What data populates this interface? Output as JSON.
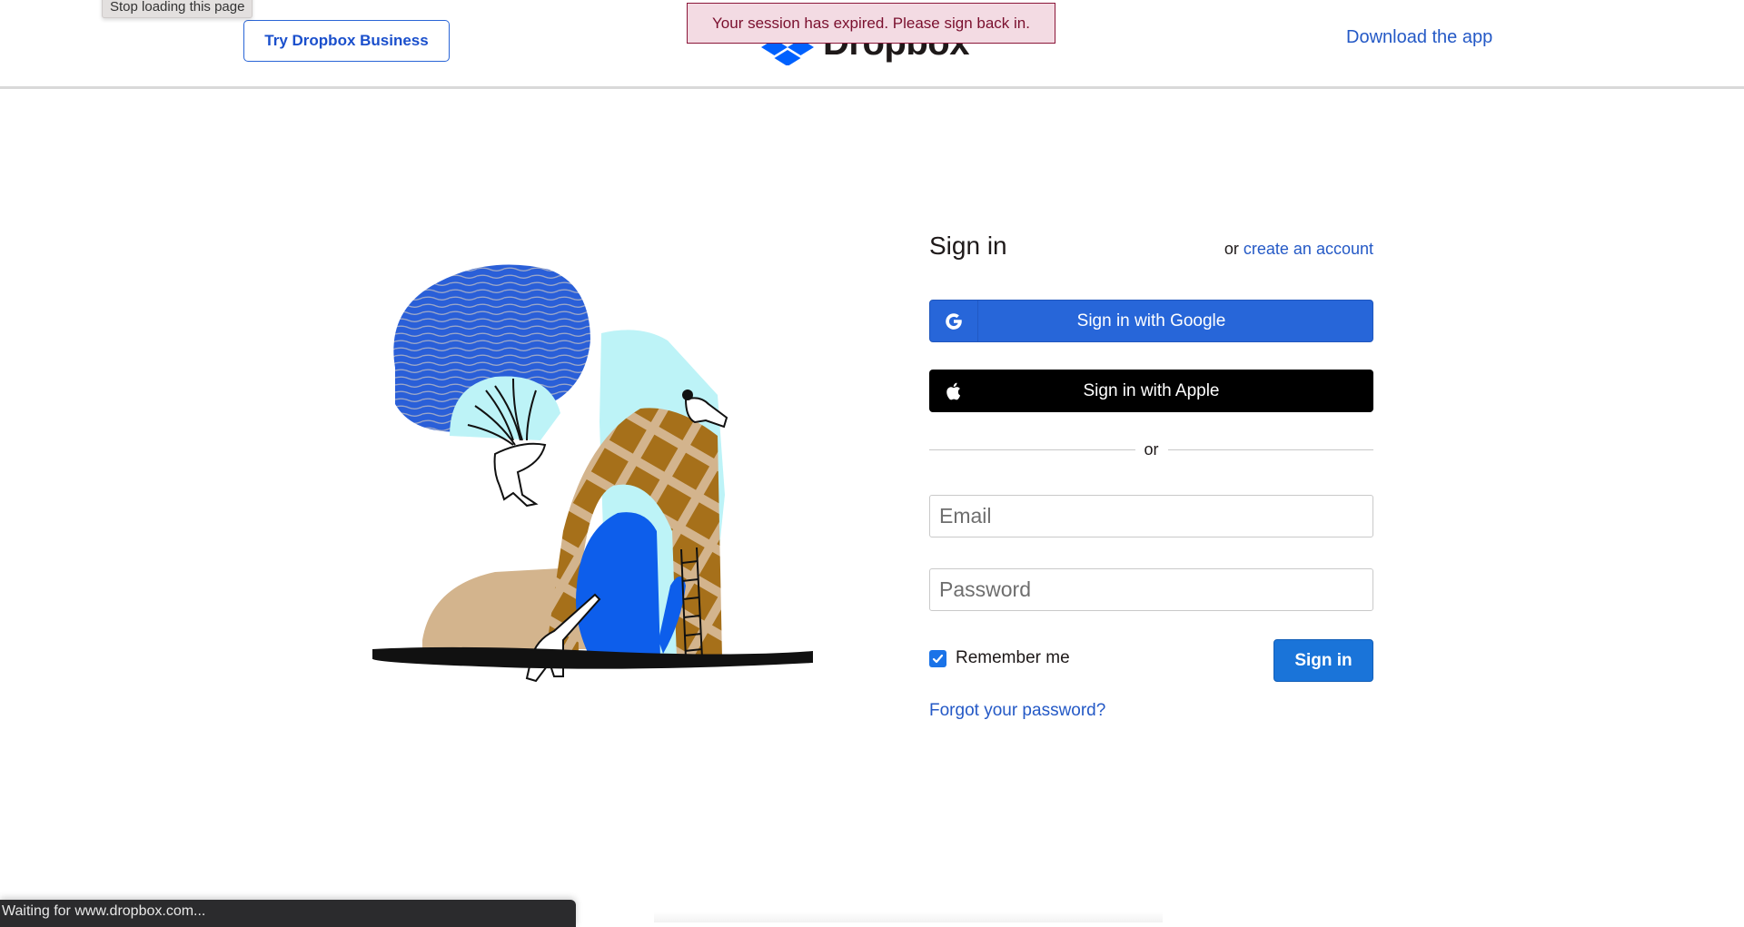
{
  "browser": {
    "tooltip": "Stop loading this page",
    "status_text": "Waiting for www.dropbox.com..."
  },
  "header": {
    "business_button": "Try Dropbox Business",
    "logo_text": "Dropbox",
    "download_link": "Download the app",
    "session_banner": "Your session has expired. Please sign back in."
  },
  "signin": {
    "title": "Sign in",
    "or_prefix": "or",
    "create_account": "create an account",
    "google_button": "Sign in with Google",
    "apple_button": "Sign in with Apple",
    "divider_text": "or",
    "email_placeholder": "Email",
    "email_value": "",
    "password_placeholder": "Password",
    "password_value": "",
    "remember_label": "Remember me",
    "remember_checked": true,
    "submit_button": "Sign in",
    "forgot_link": "Forgot your password?"
  },
  "icons": {
    "google": "google-g-icon",
    "apple": "apple-icon",
    "logo": "dropbox-logo-icon",
    "checkbox": "checkmark-icon"
  },
  "colors": {
    "brand_blue": "#0061fe",
    "link_blue": "#2459c6",
    "google_button": "#2766d9",
    "apple_button": "#000000",
    "submit_button": "#1a74d9",
    "banner_bg": "#f3dbe3",
    "banner_text": "#7a0f2e"
  }
}
